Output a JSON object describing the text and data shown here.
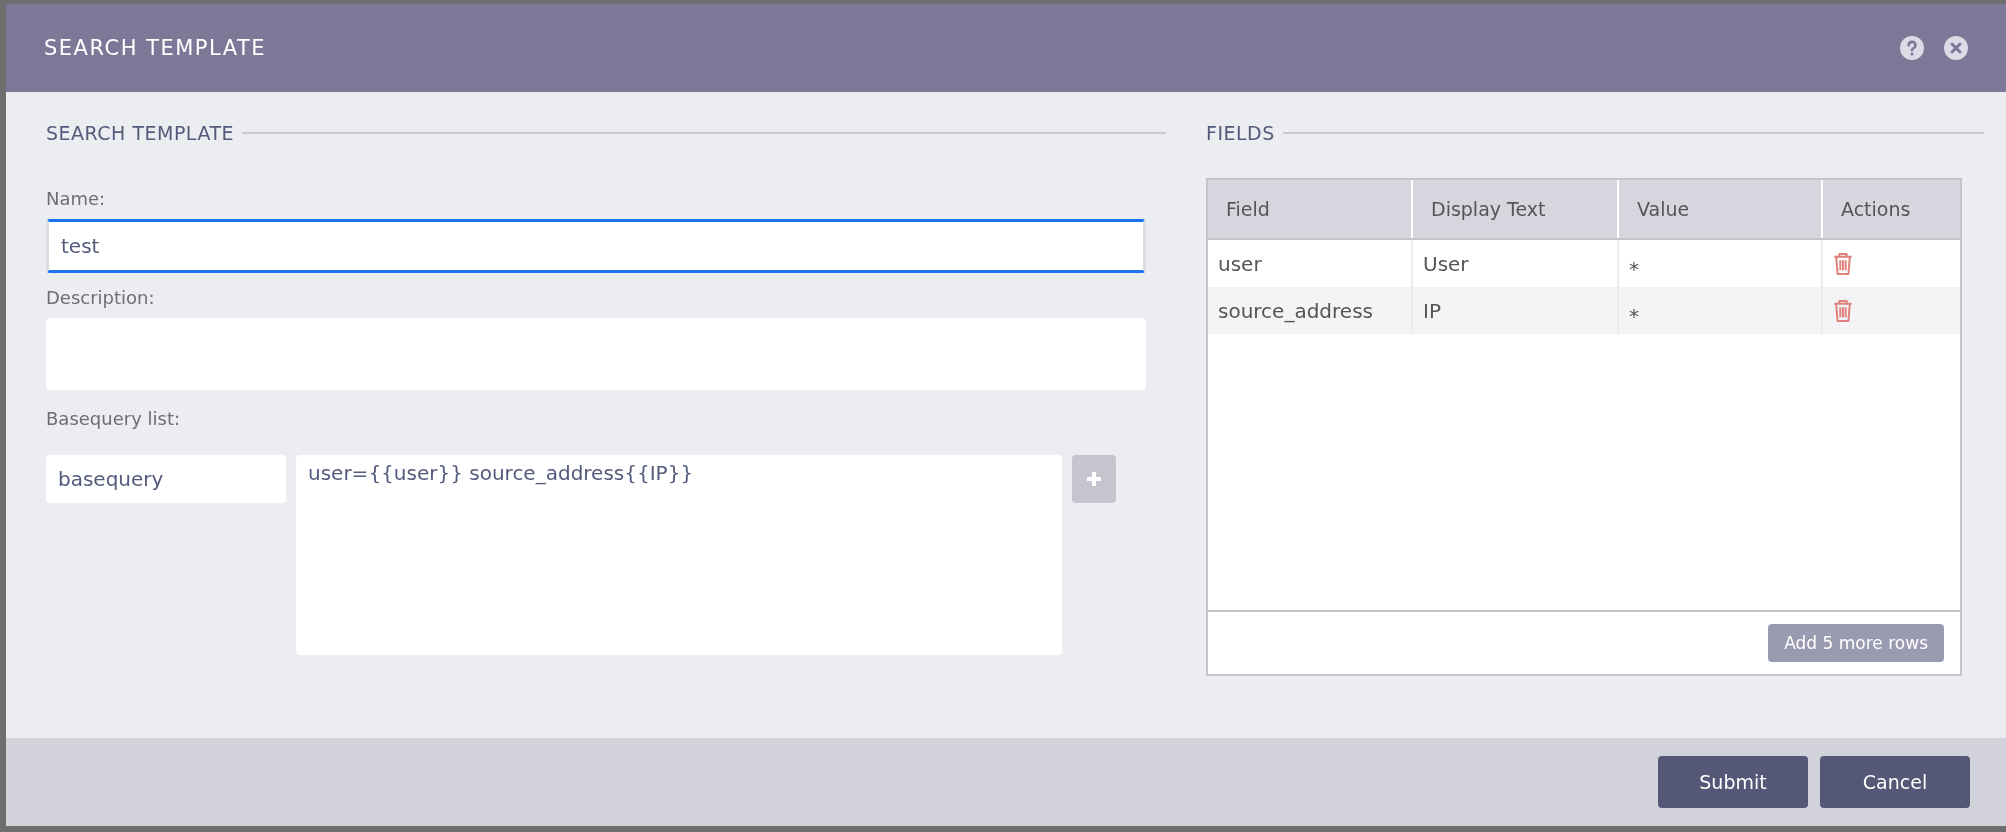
{
  "dialog": {
    "title": "SEARCH TEMPLATE"
  },
  "search_template": {
    "heading": "SEARCH TEMPLATE",
    "name": {
      "label": "Name:",
      "value": "test",
      "focused": true
    },
    "description": {
      "label": "Description:"
    },
    "basequery_list": {
      "label": "Basequery list:",
      "items": [
        {
          "name": "basequery",
          "query": "user={{user}} source_address{{IP}}"
        }
      ]
    }
  },
  "fields": {
    "heading": "FIELDS",
    "columns": [
      "Field",
      "Display Text",
      "Value",
      "Actions"
    ],
    "rows": [
      {
        "field": "user",
        "display_text": "User",
        "value": "*"
      },
      {
        "field": "source_address",
        "display_text": "IP",
        "value": "*"
      }
    ],
    "add_rows_button": "Add 5 more rows"
  },
  "buttons": [
    "Submit",
    "Cancel"
  ]
}
